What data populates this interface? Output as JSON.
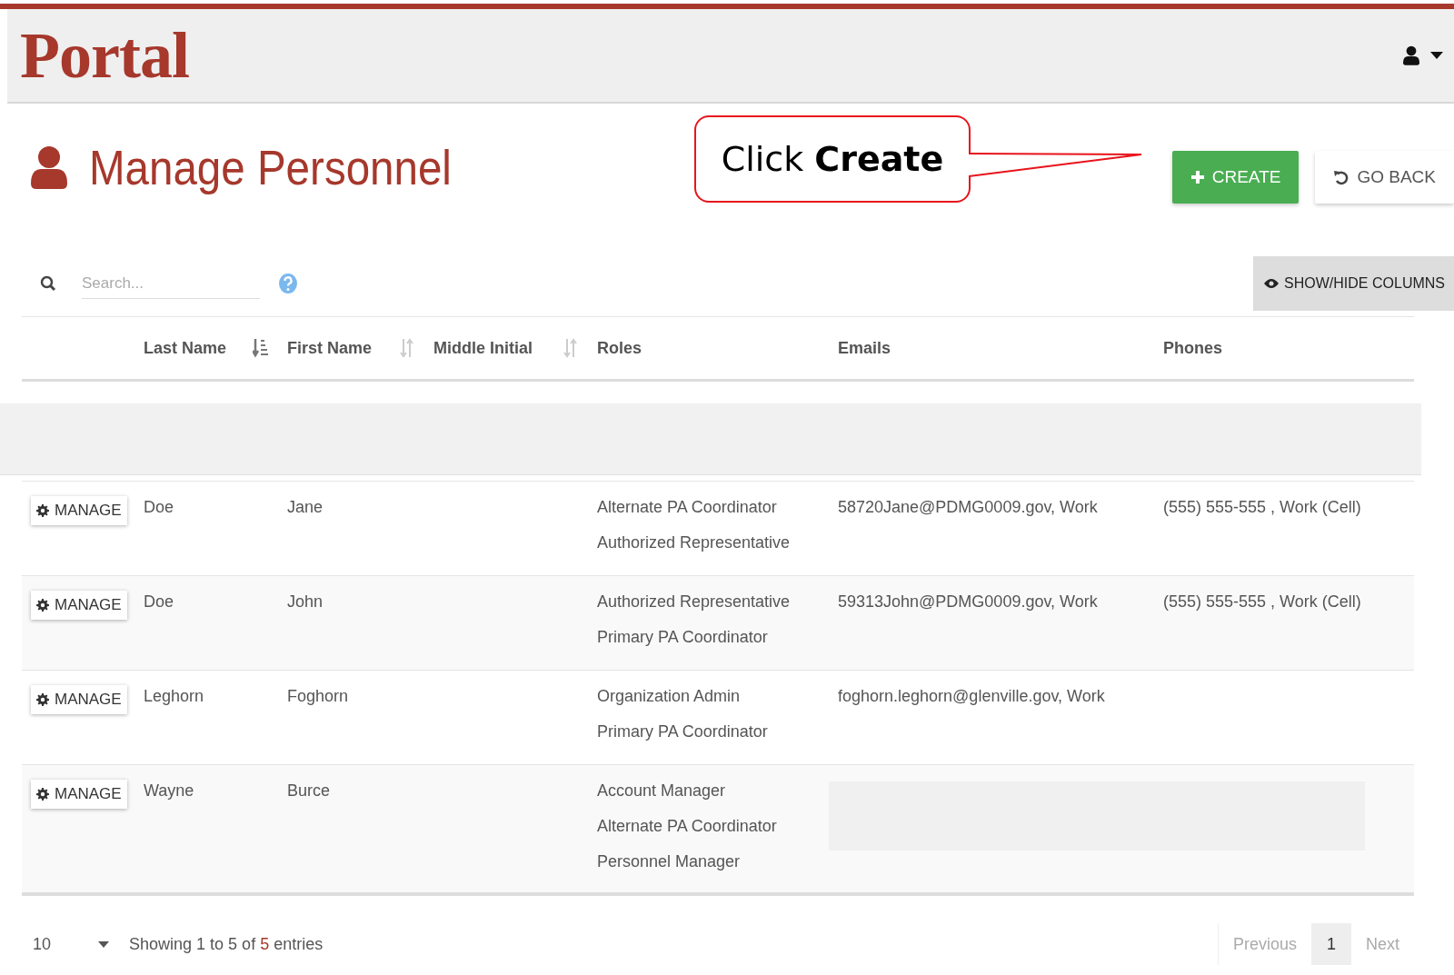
{
  "header": {
    "logo": "Portal"
  },
  "page": {
    "title": "Manage Personnel"
  },
  "callout": {
    "text": "Click **Create**"
  },
  "actions": [
    {
      "kind": "create",
      "label": "CREATE"
    },
    {
      "kind": "back",
      "label": "GO BACK"
    }
  ],
  "search": {
    "placeholder": "Search..."
  },
  "columns_button": {
    "label": "SHOW/HIDE COLUMNS"
  },
  "table": {
    "columns": [
      {
        "label": "Last Name",
        "sorted": true
      },
      {
        "label": "First Name",
        "sorted": false
      },
      {
        "label": "Middle Initial",
        "sorted": false
      },
      {
        "label": "Roles"
      },
      {
        "label": "Emails"
      },
      {
        "label": "Phones"
      }
    ],
    "rows": [
      {
        "kind": "redacted"
      },
      {
        "kind": "person",
        "action": "MANAGE",
        "last_name": "Doe",
        "first_name": "Jane",
        "roles": [
          "Alternate PA Coordinator",
          "Authorized Representative"
        ],
        "emails": "58720Jane@PDMG0009.gov, Work",
        "phones": "(555) 555-555 , Work (Cell)",
        "contact_redacted": false
      },
      {
        "kind": "person",
        "action": "MANAGE",
        "last_name": "Doe",
        "first_name": "John",
        "roles": [
          "Authorized Representative",
          "Primary PA Coordinator"
        ],
        "emails": "59313John@PDMG0009.gov, Work",
        "phones": "(555) 555-555 , Work (Cell)",
        "contact_redacted": false
      },
      {
        "kind": "person",
        "action": "MANAGE",
        "last_name": "Leghorn",
        "first_name": "Foghorn",
        "roles": [
          "Organization Admin",
          "Primary PA Coordinator"
        ],
        "emails": "foghorn.leghorn@glenville.gov, Work",
        "contact_redacted": false
      },
      {
        "kind": "person",
        "action": "MANAGE",
        "last_name": "Wayne",
        "first_name": "Burce",
        "roles": [
          "Account Manager",
          "Alternate PA Coordinator",
          "Personnel Manager"
        ],
        "contact_redacted": true
      }
    ]
  },
  "footer": {
    "page_length": "10",
    "info_prefix": "Showing 1 to 5 of",
    "info_total": "5",
    "info_suffix": "entries",
    "pages": [
      {
        "label": "Previous",
        "selected": false,
        "disabled": true
      },
      {
        "label": "1",
        "selected": true,
        "disabled": false
      },
      {
        "label": "Next",
        "selected": false,
        "disabled": true
      }
    ]
  }
}
